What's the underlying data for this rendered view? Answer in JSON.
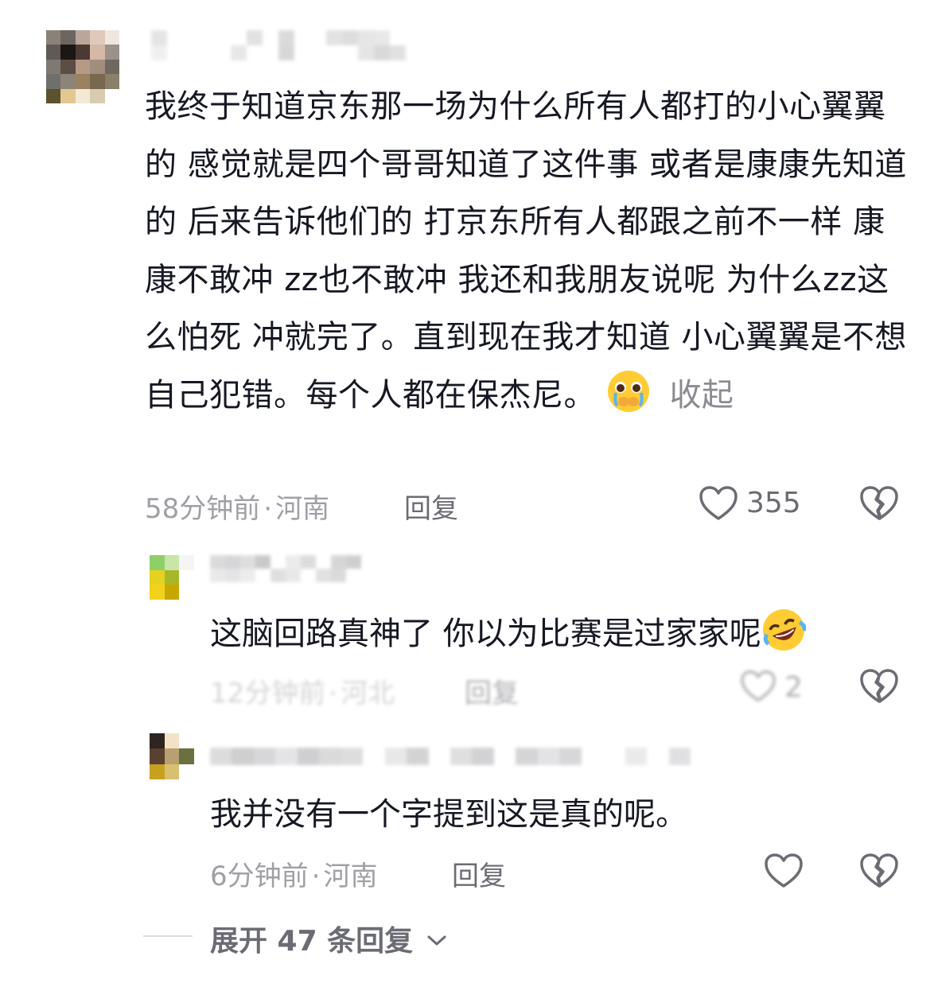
{
  "comment": {
    "text": "我终于知道京东那一场为什么所有人都打的小心翼翼的 感觉就是四个哥哥知道了这件事 或者是康康先知道的 后来告诉他们的 打京东所有人都跟之前不一样 康康不敢冲 zz也不敢冲 我还和我朋友说呢 为什么zz这么怕死 冲就完了。直到现在我才知道 小心翼翼是不想自己犯错。每个人都在保杰尼。",
    "collapse_label": "收起",
    "time": "58分钟前",
    "sep": "·",
    "location": "河南",
    "reply_label": "回复",
    "likes": "355",
    "emoji": "crying-face-emoji"
  },
  "replies": [
    {
      "text": "这脑回路真神了 你以为比赛是过家家呢",
      "emoji": "rolling-laughing-emoji",
      "time": "12分钟前",
      "sep": "·",
      "location": "河北",
      "reply_label": "回复",
      "likes": "2"
    },
    {
      "text": "我并没有一个字提到这是真的呢。",
      "time": "6分钟前",
      "sep": "·",
      "location": "河南",
      "reply_label": "回复"
    }
  ],
  "expand_label": "展开 47 条回复",
  "colors": {
    "text": "#161823",
    "meta": "#9fa0a6",
    "action": "#6b6c73"
  }
}
